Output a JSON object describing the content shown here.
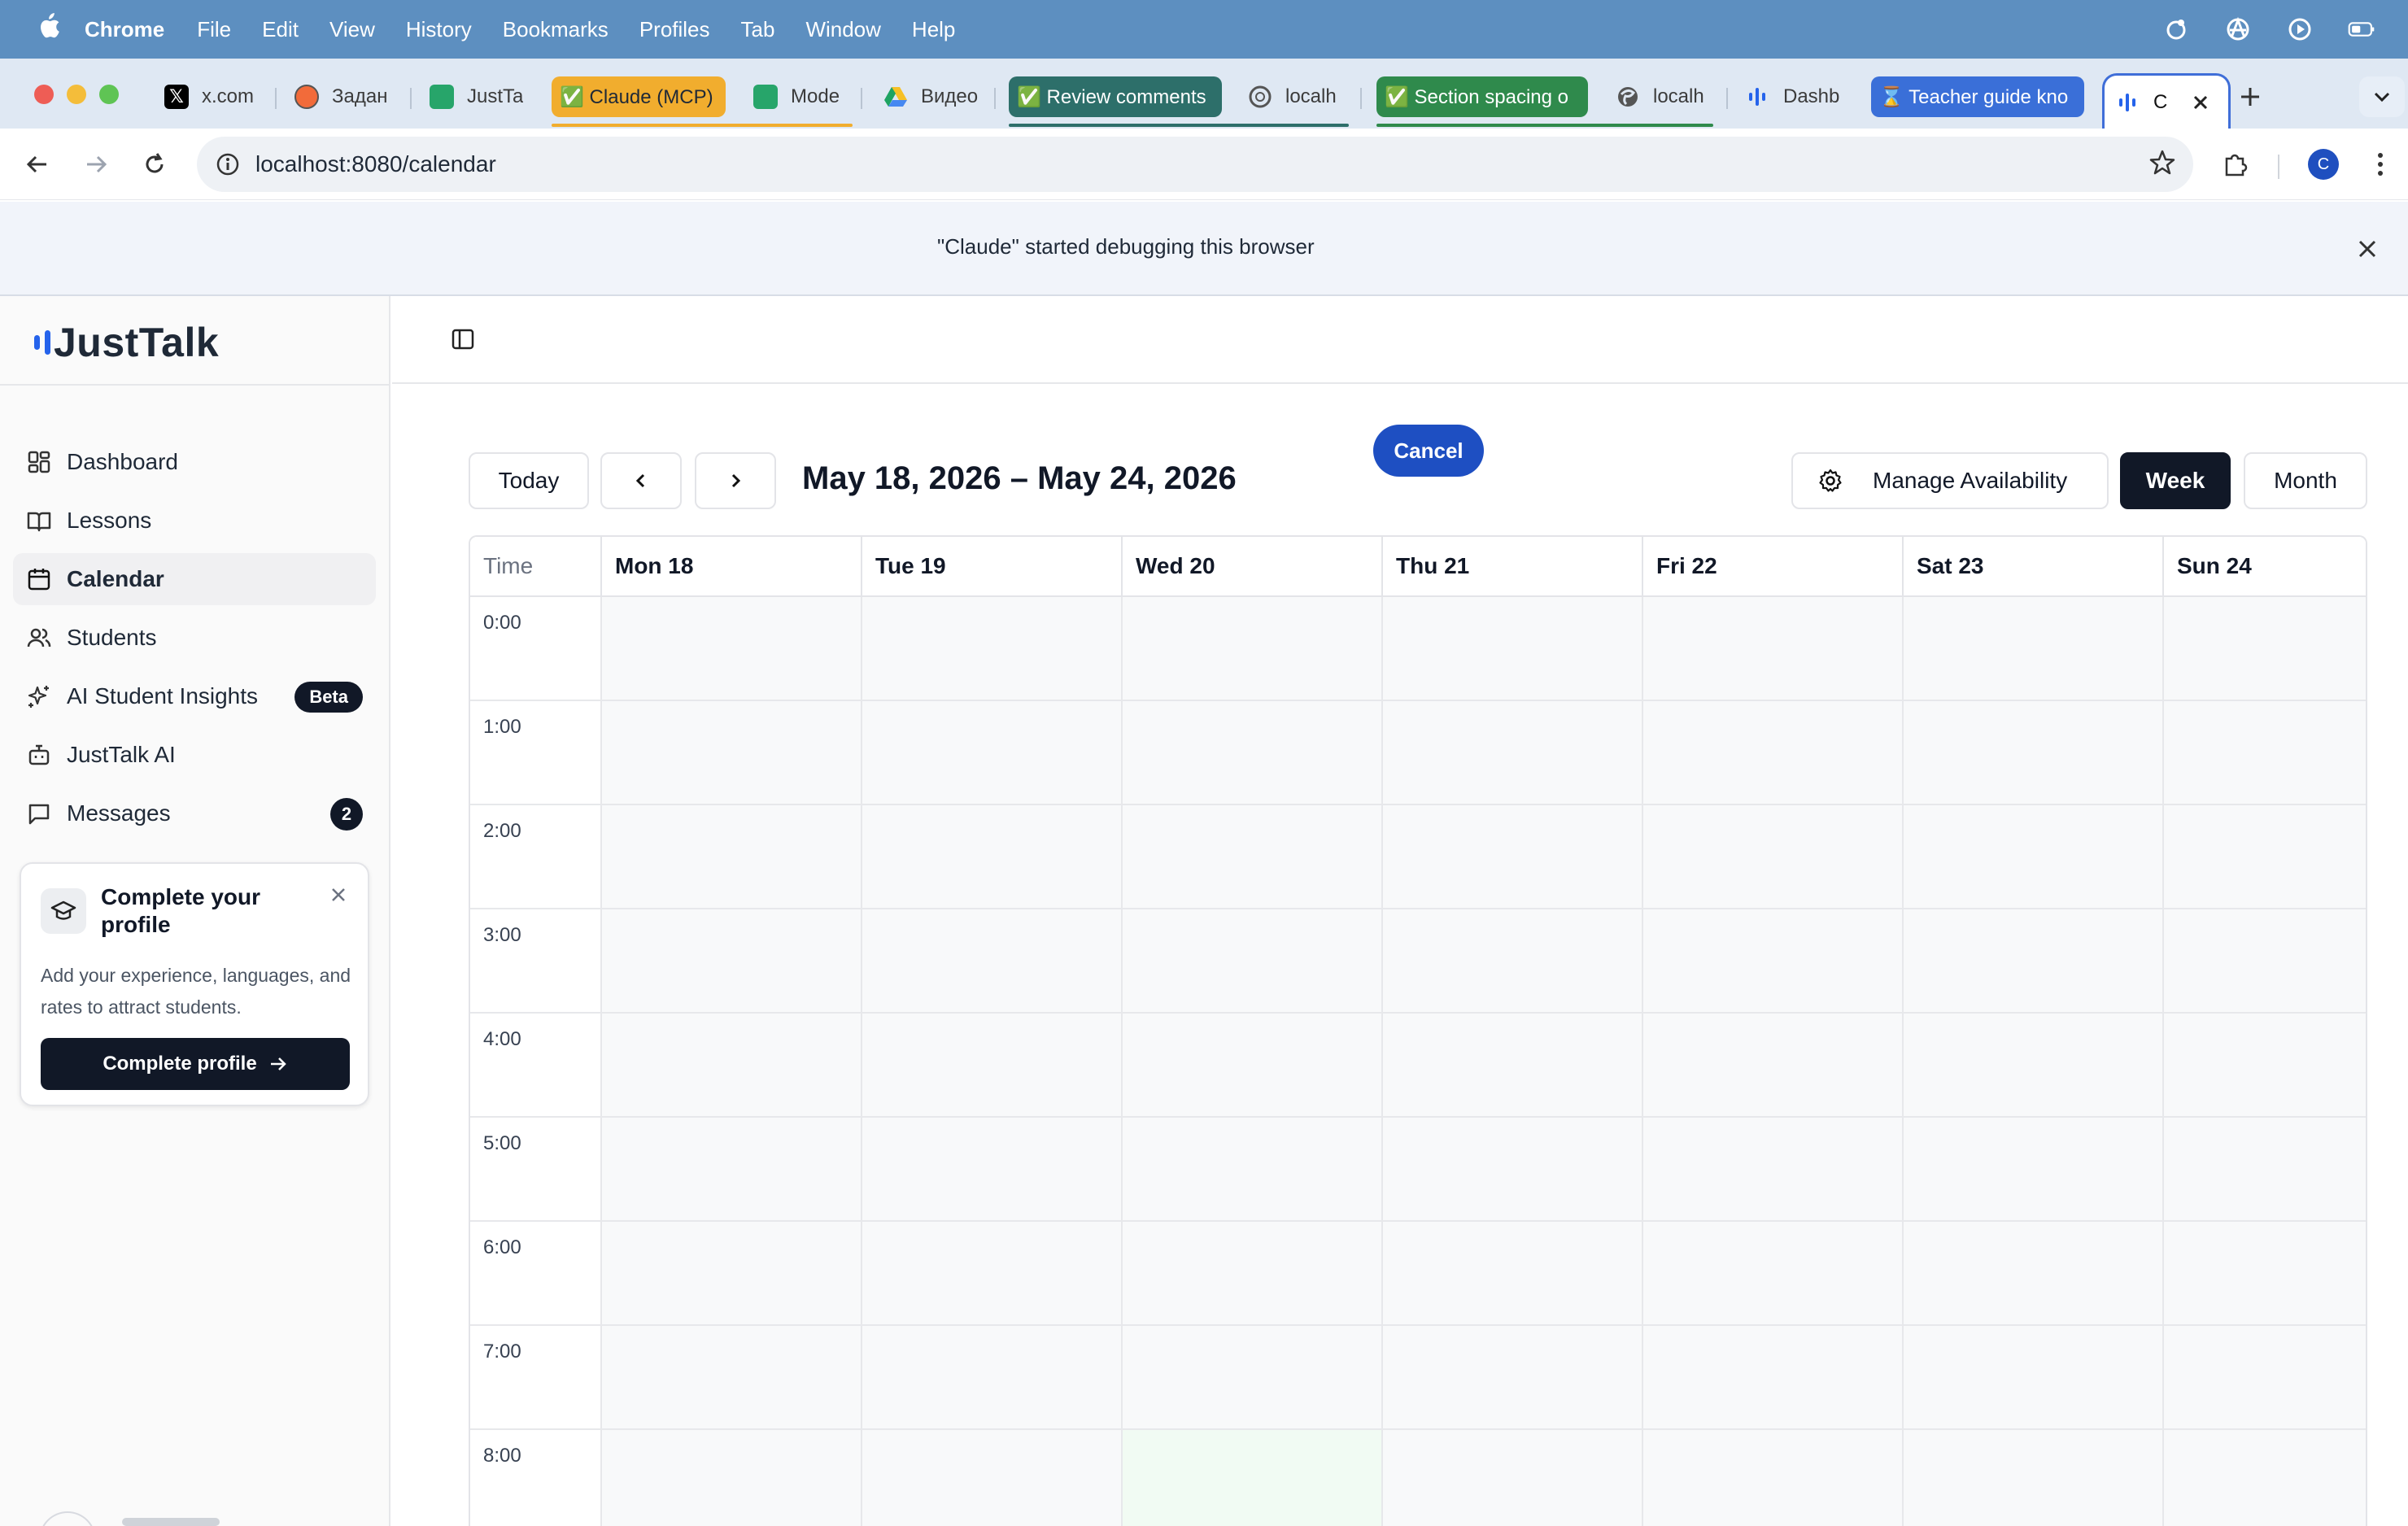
{
  "menubar": {
    "app_name": "Chrome",
    "items": [
      "File",
      "Edit",
      "View",
      "History",
      "Bookmarks",
      "Profiles",
      "Tab",
      "Window",
      "Help"
    ]
  },
  "tabs": [
    {
      "label": "x.com"
    },
    {
      "label": "Задан"
    },
    {
      "label": "JustTa"
    },
    {
      "label": "✅ Claude (MCP)"
    },
    {
      "label": "Mode"
    },
    {
      "label": "Видео"
    },
    {
      "label": "✅ Review comments"
    },
    {
      "label": "localh"
    },
    {
      "label": "✅ Section spacing o"
    },
    {
      "label": "localh"
    },
    {
      "label": "Dashb"
    },
    {
      "label": "⌛ Teacher guide kno"
    },
    {
      "label": "C"
    }
  ],
  "address_bar": {
    "url": "localhost:8080/calendar"
  },
  "debug_banner": {
    "message": "\"Claude\" started debugging this browser",
    "cancel_label": "Cancel"
  },
  "profile_avatar_letter": "C",
  "app": {
    "logo_text": "JustTalk",
    "nav": [
      {
        "label": "Dashboard"
      },
      {
        "label": "Lessons"
      },
      {
        "label": "Calendar"
      },
      {
        "label": "Students"
      },
      {
        "label": "AI Student Insights",
        "badge": "Beta"
      },
      {
        "label": "JustTalk AI"
      },
      {
        "label": "Messages",
        "count": "2"
      }
    ],
    "profile_card": {
      "title": "Complete your profile",
      "description": "Add your experience, languages, and rates to attract students.",
      "button": "Complete profile"
    }
  },
  "calendar": {
    "today_label": "Today",
    "range": "May 18, 2026 – May 24, 2026",
    "manage_label": "Manage Availability",
    "view_week": "Week",
    "view_month": "Month",
    "active_view": "Week",
    "time_header": "Time",
    "days": [
      "Mon 18",
      "Tue 19",
      "Wed 20",
      "Thu 21",
      "Fri 22",
      "Sat 23",
      "Sun 24"
    ],
    "hours": [
      "0:00",
      "1:00",
      "2:00",
      "3:00",
      "4:00",
      "5:00",
      "6:00",
      "7:00",
      "8:00"
    ]
  },
  "colors": {
    "menubar": "#5d8fc0",
    "accent": "#1e4fc2",
    "dark": "#111827",
    "highlight_cell": "#f1fbf3"
  }
}
